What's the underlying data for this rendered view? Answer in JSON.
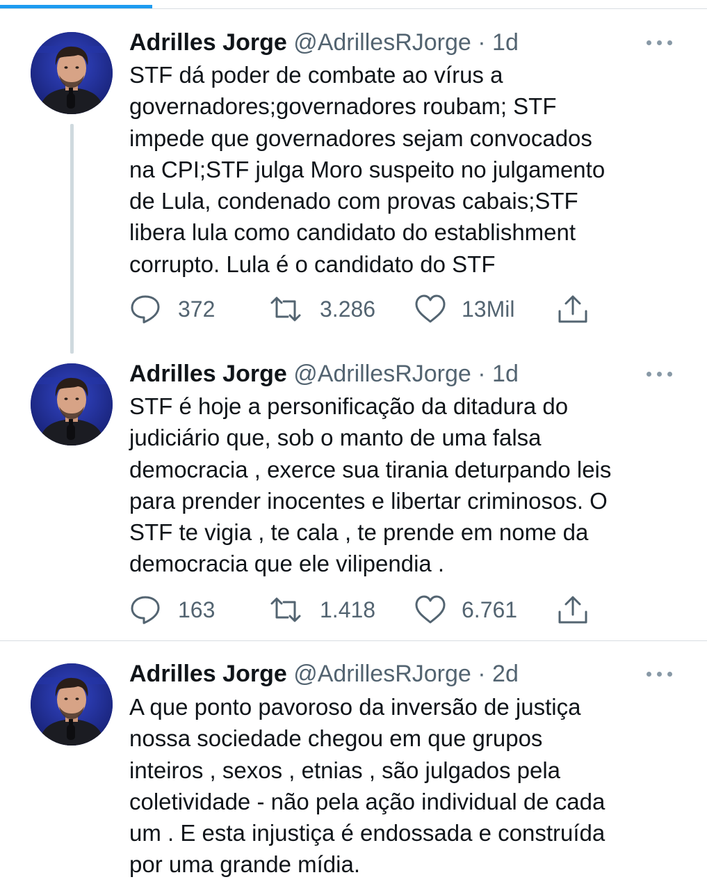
{
  "scroll_progress": 0.215,
  "colors": {
    "accent": "#1d9bf0",
    "secondary_text": "#536471",
    "primary_text": "#0f1419"
  },
  "tweets": [
    {
      "author_name": "Adrilles Jorge",
      "handle": "@AdrillesRJorge",
      "separator": "·",
      "time": "1d",
      "avatar_icon": "user-avatar",
      "text_lines": [
        "STF dá  poder de combate ao vírus a",
        "governadores;governadores roubam; STF",
        "impede que governadores sejam convocados",
        "na CPI;STF julga Moro suspeito no julgamento",
        "de Lula, condenado com provas cabais;STF",
        "libera lula como candidato do establishment",
        "corrupto. Lula é o candidato do STF"
      ],
      "replies": "372",
      "retweets": "3.286",
      "likes": "13Mil"
    },
    {
      "author_name": "Adrilles Jorge",
      "handle": "@AdrillesRJorge",
      "separator": "·",
      "time": "1d",
      "avatar_icon": "user-avatar",
      "text_lines": [
        "STF é hoje a personificação da ditadura do",
        "judiciário que, sob o manto de uma falsa",
        "democracia , exerce sua tirania deturpando leis",
        "para prender inocentes e libertar criminosos. O",
        "STF te vigia , te cala , te prende em nome da",
        "democracia que ele vilipendia ."
      ],
      "replies": "163",
      "retweets": "1.418",
      "likes": "6.761"
    },
    {
      "author_name": "Adrilles Jorge",
      "handle": "@AdrillesRJorge",
      "separator": "·",
      "time": "2d",
      "avatar_icon": "user-avatar",
      "text_lines": [
        "A que ponto pavoroso da inversão de justiça",
        "nossa sociedade chegou em que grupos",
        "inteiros , sexos , etnias , são julgados pela",
        "coletividade - não pela ação individual de cada",
        "um . E esta injustiça é endossada e construída",
        "por uma grande mídia."
      ]
    }
  ]
}
